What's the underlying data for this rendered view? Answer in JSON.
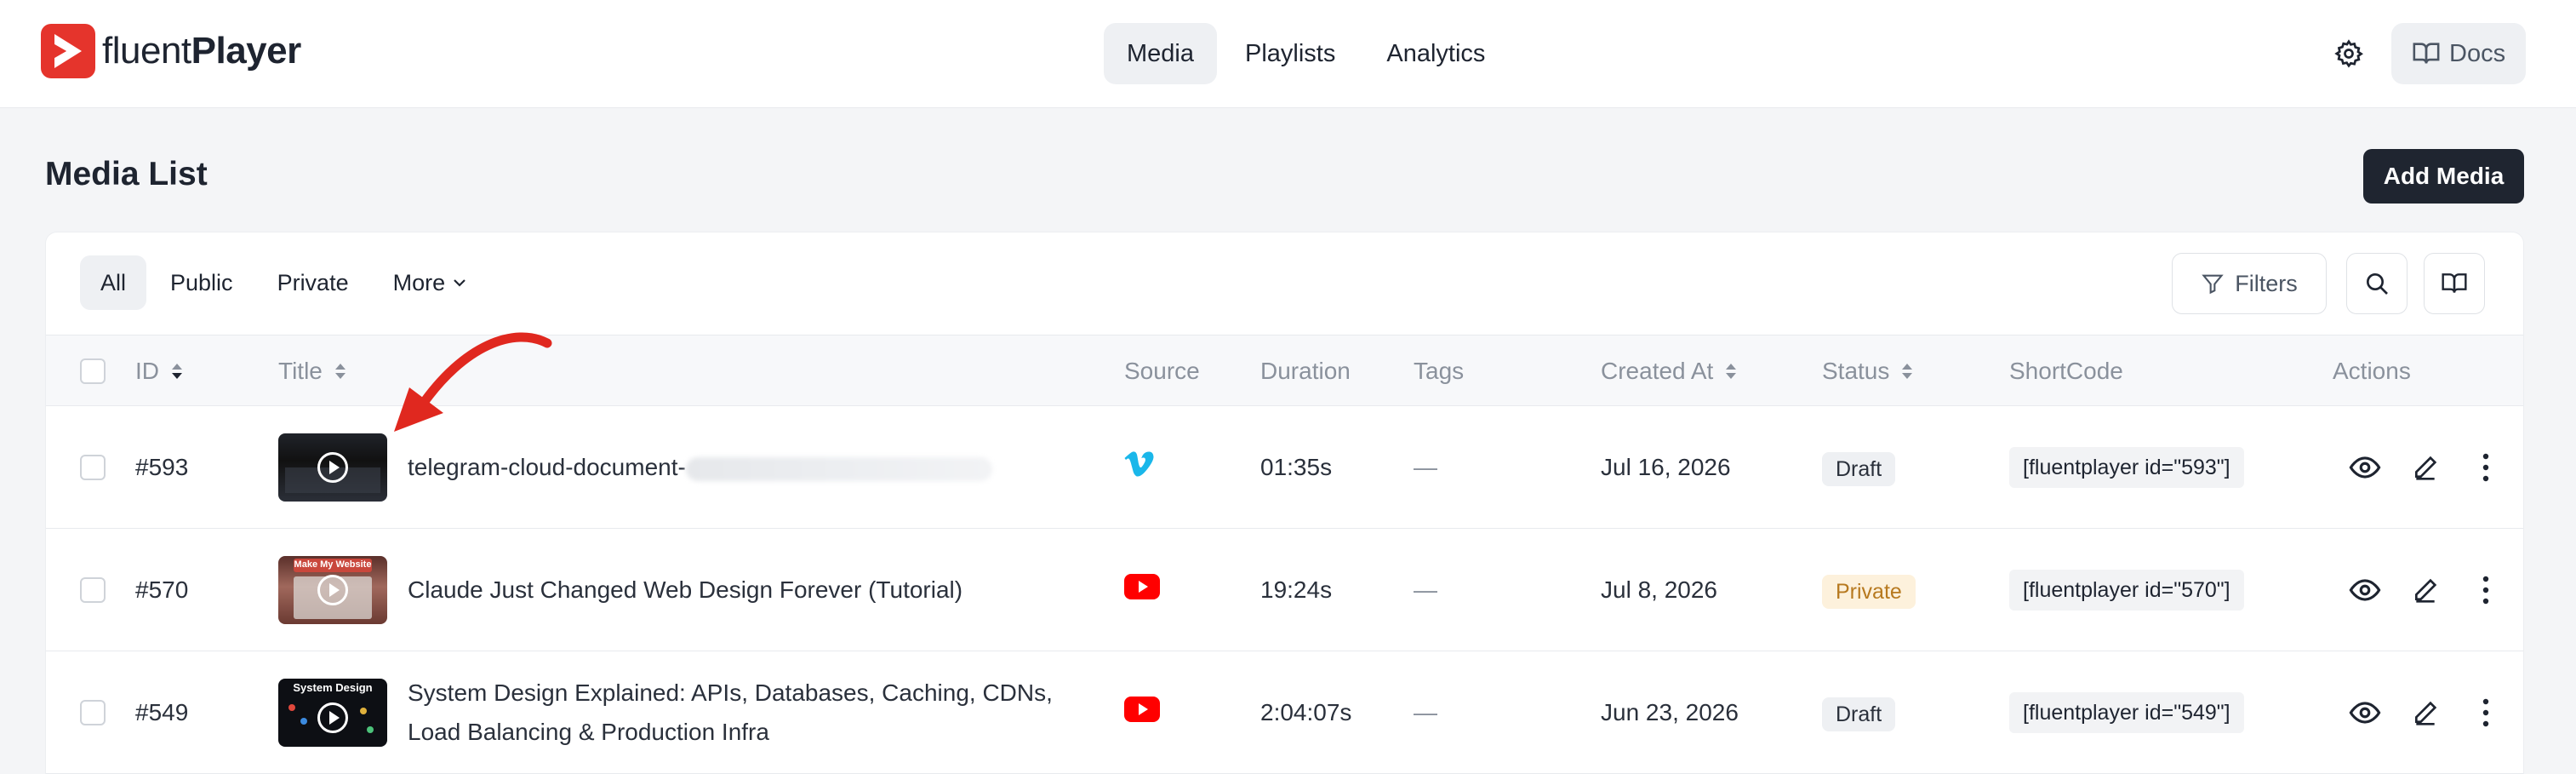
{
  "brand": {
    "name_light": "fluent",
    "name_bold": "Player",
    "color": "#e5342c"
  },
  "nav": {
    "items": [
      {
        "label": "Media",
        "active": true
      },
      {
        "label": "Playlists",
        "active": false
      },
      {
        "label": "Analytics",
        "active": false
      }
    ]
  },
  "header": {
    "docs_label": "Docs"
  },
  "page": {
    "title": "Media List",
    "add_button": "Add Media"
  },
  "tabs": {
    "all": "All",
    "public": "Public",
    "private": "Private",
    "more": "More",
    "active": "All"
  },
  "toolbar": {
    "filters_label": "Filters"
  },
  "table": {
    "columns": {
      "id": "ID",
      "title": "Title",
      "source": "Source",
      "duration": "Duration",
      "tags": "Tags",
      "created": "Created At",
      "status": "Status",
      "shortcode": "ShortCode",
      "actions": "Actions"
    },
    "rows": [
      {
        "id": "#593",
        "title": "telegram-cloud-document-",
        "title_line2": "",
        "source": "vimeo-icon",
        "duration": "01:35s",
        "tags": "—",
        "created": "Jul 16, 2026",
        "status": "Draft",
        "shortcode": "[fluentplayer id=\"593\"]"
      },
      {
        "id": "#570",
        "title": "Claude Just Changed Web Design Forever (Tutorial)",
        "title_line2": "",
        "thumb_label": "Make My Website",
        "source": "youtube-icon",
        "duration": "19:24s",
        "tags": "—",
        "created": "Jul 8, 2026",
        "status": "Private",
        "shortcode": "[fluentplayer id=\"570\"]"
      },
      {
        "id": "#549",
        "title": "System Design Explained: APIs, Databases, Caching, CDNs,",
        "title_line2": "Load Balancing & Production Infra",
        "thumb_label": "System Design",
        "source": "youtube-icon",
        "duration": "2:04:07s",
        "tags": "—",
        "created": "Jun 23, 2026",
        "status": "Draft",
        "shortcode": "[fluentplayer id=\"549\"]"
      }
    ]
  },
  "colors": {
    "vimeo": "#1ab7ea",
    "youtube": "#ff0000",
    "annotation_arrow": "#e0281f"
  }
}
